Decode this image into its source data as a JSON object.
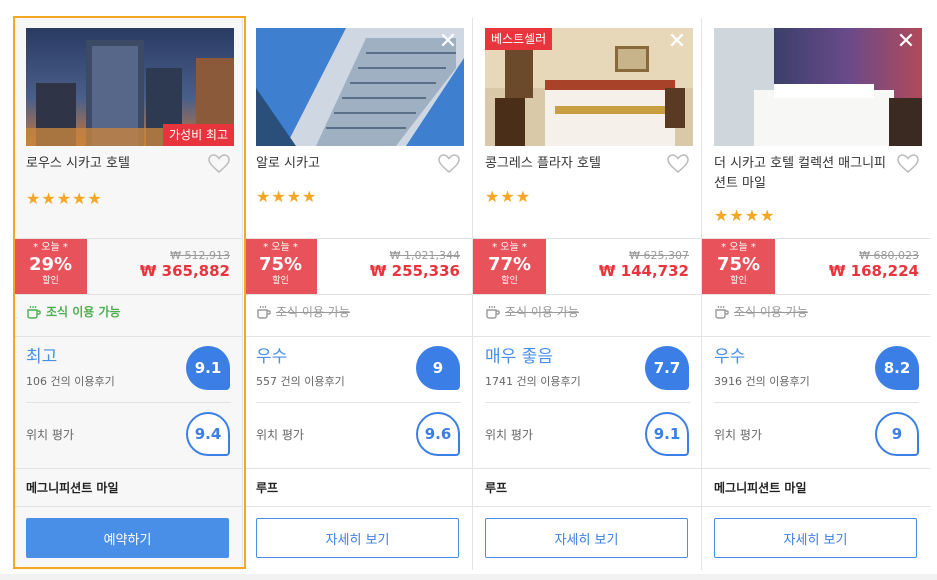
{
  "colors": {
    "accent_blue": "#4a8fe7",
    "deal_red": "#e8535b",
    "price_red": "#e8343c",
    "selected_border": "#f5a623",
    "breakfast_green": "#4caf50"
  },
  "icons": {
    "close": "close-icon",
    "heart": "heart-icon",
    "breakfast": "coffee-cup-icon"
  },
  "hotels": [
    {
      "name": "로우스 시카고 호텔",
      "star_rating": 4.5,
      "stars": "★★★★★",
      "ribbon_bottom": "가성비 최고",
      "deal_today": "* 오늘 *",
      "deal_percent": "29%",
      "deal_label": "할인",
      "old_price": "₩ 512,913",
      "new_price": "₩ 365,882",
      "breakfast": "조식 이용 가능",
      "rating_word": "최고",
      "review_count": "106 건의 이용후기",
      "score": "9.1",
      "location_label": "위치 평가",
      "location_score": "9.4",
      "area": "메그니피션트 마일",
      "button": "예약하기"
    },
    {
      "name": "알로 시카고",
      "star_rating": 4,
      "stars": "★★★★",
      "deal_today": "* 오늘 *",
      "deal_percent": "75%",
      "deal_label": "할인",
      "old_price": "₩ 1,021,344",
      "new_price": "₩ 255,336",
      "breakfast": "조식 이용 가능",
      "rating_word": "우수",
      "review_count": "557 건의 이용후기",
      "score": "9",
      "location_label": "위치 평가",
      "location_score": "9.6",
      "area": "루프",
      "button": "자세히 보기"
    },
    {
      "name": "콩그레스 플라자 호텔",
      "star_rating": 2.5,
      "stars": "★★★",
      "ribbon_top": "베스트셀러",
      "deal_today": "* 오늘 *",
      "deal_percent": "77%",
      "deal_label": "할인",
      "old_price": "₩ 625,307",
      "new_price": "₩ 144,732",
      "breakfast": "조식 이용 가능",
      "rating_word": "매우 좋음",
      "review_count": "1741 건의 이용후기",
      "score": "7.7",
      "location_label": "위치 평가",
      "location_score": "9.1",
      "area": "루프",
      "button": "자세히 보기"
    },
    {
      "name": "더 시카고 호텔 컬렉션 매그니피션트 마일",
      "star_rating": 4,
      "stars": "★★★★",
      "deal_today": "* 오늘 *",
      "deal_percent": "75%",
      "deal_label": "할인",
      "old_price": "₩ 680,023",
      "new_price": "₩ 168,224",
      "breakfast": "조식 이용 가능",
      "rating_word": "우수",
      "review_count": "3916 건의 이용후기",
      "score": "8.2",
      "location_label": "위치 평가",
      "location_score": "9",
      "area": "메그니피션트 마일",
      "button": "자세히 보기"
    }
  ]
}
